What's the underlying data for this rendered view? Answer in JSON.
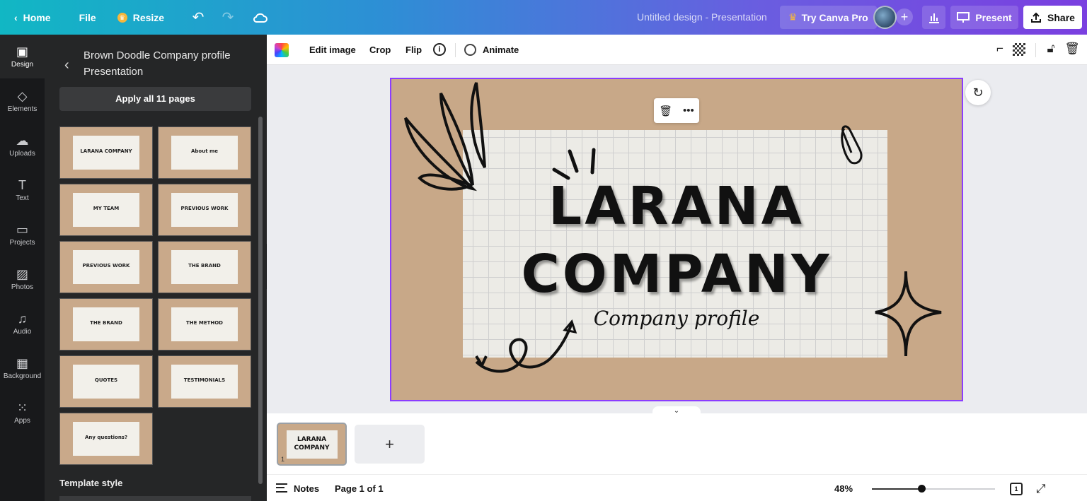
{
  "topbar": {
    "home_label": "Home",
    "file_label": "File",
    "resize_label": "Resize",
    "doc_title": "Untitled design - Presentation",
    "try_pro_label": "Try Canva Pro",
    "present_label": "Present",
    "share_label": "Share"
  },
  "rail": {
    "items": [
      {
        "label": "Design",
        "icon": "layout-icon"
      },
      {
        "label": "Elements",
        "icon": "shapes-icon"
      },
      {
        "label": "Uploads",
        "icon": "cloud-upload-icon"
      },
      {
        "label": "Text",
        "icon": "text-icon"
      },
      {
        "label": "Projects",
        "icon": "folder-icon"
      },
      {
        "label": "Photos",
        "icon": "image-icon"
      },
      {
        "label": "Audio",
        "icon": "music-icon"
      },
      {
        "label": "Background",
        "icon": "pattern-icon"
      },
      {
        "label": "Apps",
        "icon": "grid-icon"
      }
    ]
  },
  "panel": {
    "title": "Brown Doodle Company profile Presentation",
    "apply_label": "Apply all 11 pages",
    "thumbnails": [
      {
        "label": "LARANA COMPANY"
      },
      {
        "label": "About me"
      },
      {
        "label": "MY TEAM"
      },
      {
        "label": "PREVIOUS WORK"
      },
      {
        "label": "PREVIOUS WORK"
      },
      {
        "label": "THE BRAND"
      },
      {
        "label": "THE BRAND"
      },
      {
        "label": "THE METHOD"
      },
      {
        "label": "QUOTES"
      },
      {
        "label": "TESTIMONIALS"
      },
      {
        "label": "Any questions?"
      }
    ],
    "template_style_label": "Template style"
  },
  "context_toolbar": {
    "edit_image_label": "Edit image",
    "crop_label": "Crop",
    "flip_label": "Flip",
    "animate_label": "Animate"
  },
  "slide": {
    "title_line1": "LARANA",
    "title_line2": "COMPANY",
    "subtitle": "Company profile"
  },
  "pages": {
    "thumb_line1": "LARANA",
    "thumb_line2": "COMPANY",
    "page_number": "1",
    "add_label": "+"
  },
  "status": {
    "notes_label": "Notes",
    "page_count": "Page 1 of 1",
    "zoom": "48%",
    "zoom_fraction": 0.4,
    "pages_icon_number": "1"
  },
  "colors": {
    "selection": "#8b3dff",
    "kraft": "#c8a888",
    "panel_bg": "#252627",
    "rail_bg": "#18191b"
  }
}
